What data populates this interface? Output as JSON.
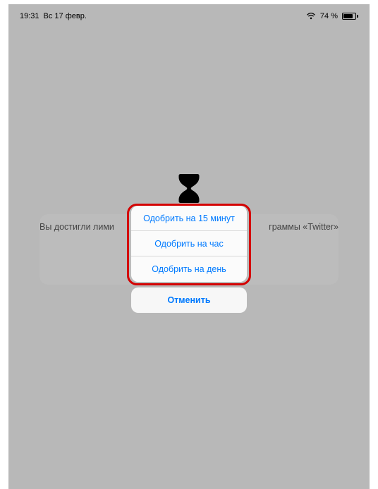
{
  "statusBar": {
    "time": "19:31",
    "date": "Вс 17 февр.",
    "batteryPercent": "74 %"
  },
  "limitScreen": {
    "messageLeft": "Вы достигли лими",
    "messageRight": "граммы «Twitter»"
  },
  "actionSheet": {
    "options": [
      "Одобрить на 15 минут",
      "Одобрить на час",
      "Одобрить на день"
    ],
    "cancel": "Отменить"
  }
}
